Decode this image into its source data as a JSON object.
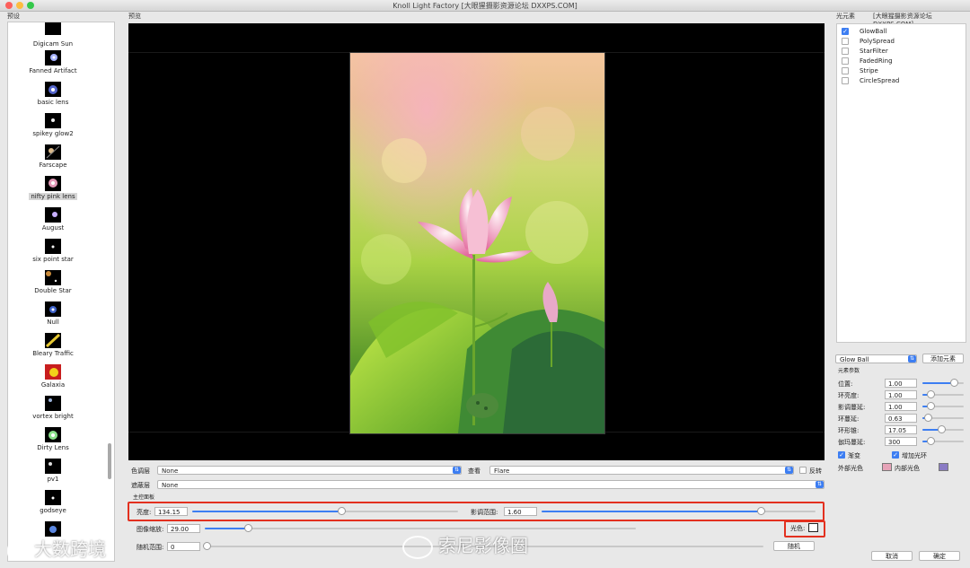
{
  "window": {
    "title": "Knoll Light Factory [大眼猩摄影资源论坛 DXXPS.COM]"
  },
  "presets_panel": {
    "label": "预设",
    "items": [
      {
        "name": "Digicam Sun"
      },
      {
        "name": "Fanned Artifact"
      },
      {
        "name": "basic lens"
      },
      {
        "name": "spikey glow2"
      },
      {
        "name": "Farscape"
      },
      {
        "name": "nifty pink lens",
        "selected": true
      },
      {
        "name": "August"
      },
      {
        "name": "six point star"
      },
      {
        "name": "Double Star"
      },
      {
        "name": "Null"
      },
      {
        "name": "Bleary Traffic"
      },
      {
        "name": "Galaxia"
      },
      {
        "name": "vortex bright"
      },
      {
        "name": "Dirty Lens"
      },
      {
        "name": "pv1"
      },
      {
        "name": "godseye"
      }
    ]
  },
  "preview": {
    "label": "预览"
  },
  "controls": {
    "color_layer_label": "色调层",
    "color_layer_value": "None",
    "view_label": "查看",
    "view_value": "Flare",
    "invert_label": "反转",
    "mask_label": "遮蔽层",
    "mask_value": "None",
    "main_panel_label": "主控面板",
    "brightness_label": "亮度:",
    "brightness_value": "134.15",
    "brightness_fraction": 0.56,
    "shading_range_label": "影调范围:",
    "shading_range_value": "1.60",
    "shading_range_fraction": 0.8,
    "image_scale_label": "图像缩放:",
    "image_scale_value": "29.00",
    "image_scale_fraction": 0.1,
    "light_color_label": "光色:",
    "random_range_label": "随机范围:",
    "random_range_value": "0",
    "random_range_fraction": 0.0,
    "random_button": "随机"
  },
  "elements_panel": {
    "label": "光元素",
    "header": "[大眼猩摄影资源论坛 DXXPS.COM]",
    "items": [
      {
        "name": "GlowBall",
        "checked": true
      },
      {
        "name": "PolySpread",
        "checked": false
      },
      {
        "name": "StarFilter",
        "checked": false
      },
      {
        "name": "FadedRing",
        "checked": false
      },
      {
        "name": "Stripe",
        "checked": false
      },
      {
        "name": "CircleSpread",
        "checked": false
      }
    ],
    "element_select": "Glow Ball",
    "add_element_button": "添加元素",
    "params_label": "元素参数",
    "params": [
      {
        "label": "位置:",
        "value": "1.00",
        "fraction": 0.75
      },
      {
        "label": "环亮度:",
        "value": "1.00",
        "fraction": 0.2
      },
      {
        "label": "影调蔓延:",
        "value": "1.00",
        "fraction": 0.2
      },
      {
        "label": "环蔓延:",
        "value": "0.63",
        "fraction": 0.12
      },
      {
        "label": "环形锥:",
        "value": "17.05",
        "fraction": 0.45
      },
      {
        "label": "伽玛蔓延:",
        "value": "300",
        "fraction": 0.2
      }
    ],
    "gradient_label": "渐变",
    "add_ring_label": "增加光环",
    "outer_color_label": "外部光色",
    "inner_color_label": "内部光色",
    "outer_color": "#e6a3b8",
    "inner_color": "#8a7bc4",
    "cancel_button": "取消",
    "ok_button": "确定"
  },
  "watermarks": {
    "left": "大数跨境",
    "center": "索尼影像圈"
  },
  "colors": {
    "accent": "#3d7ef2",
    "highlight": "#e3301f"
  }
}
